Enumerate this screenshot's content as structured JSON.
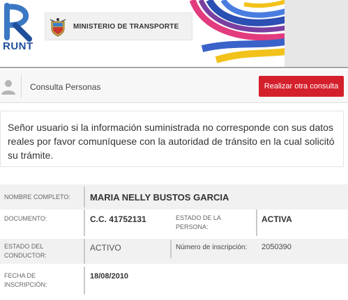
{
  "header": {
    "runt_text": "RUNT",
    "ministry_name": "MINISTERIO DE TRANSPORTE"
  },
  "toolbar": {
    "title": "Consulta Personas",
    "button_label": "Realizar otra consulta"
  },
  "notice": {
    "text": "Señor usuario si la información suministrada no corresponde con sus datos reales por favor comuníquese con la autoridad de tránsito en la cual solicitó su trámite."
  },
  "details": {
    "nombre_label": "NOMBRE COMPLETO:",
    "nombre_value": "MARIA NELLY BUSTOS GARCIA",
    "documento_label": "DOCUMENTO:",
    "documento_value": "C.C. 41752131",
    "estado_persona_label": "ESTADO DE LA PERSONA:",
    "estado_persona_value": "ACTIVA",
    "estado_conductor_label": "ESTADO DEL CONDUCTOR:",
    "estado_conductor_value": "ACTIVO",
    "inscripcion_num_label": "Número de inscripción:",
    "inscripcion_num_value": "2050390",
    "fecha_label": "FECHA DE INSCRIPCIÓN:",
    "fecha_value": "18/08/2010"
  },
  "colors": {
    "accent_red": "#d4202c",
    "runt_blue": "#1f4e9b"
  }
}
